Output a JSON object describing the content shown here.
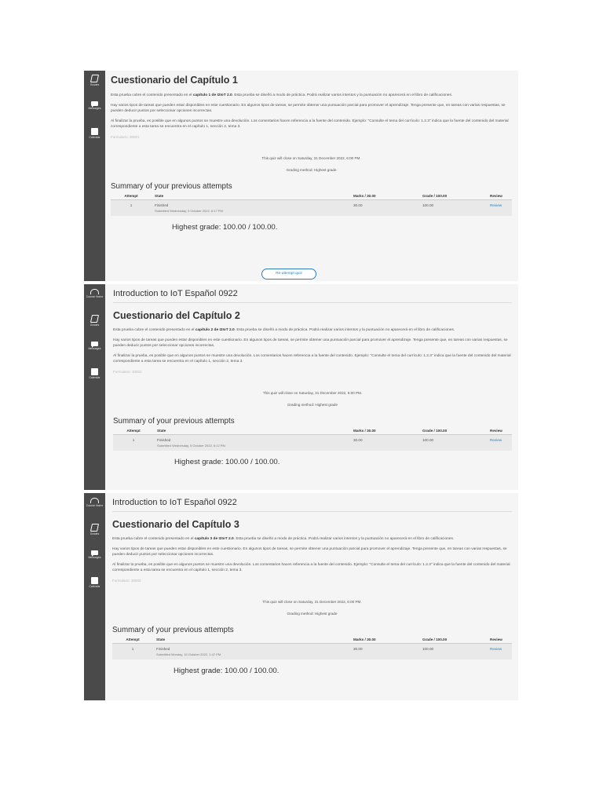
{
  "rail": {
    "course_home": "Course Home",
    "grades": "Grades",
    "messages": "Messages",
    "calendar": "Calendar"
  },
  "common": {
    "course_title": "Introduction to IoT Español 0922",
    "para2": "Hay varios tipos de tareas que pueden estar disponibles en este cuestionario. En algunos tipos de tareas, se permite obtener una puntuación parcial para promover el aprendizaje. Tenga presente que, en tareas con varias respuestas, se pueden deducir puntos por seleccionar opciones incorrectas.",
    "para3": "Al finalizar la prueba, es posible que en algunos puntos se muestre una devolución. Los comentarios hacen referencia a la fuente del contenido. Ejemplo: \"Consulte el tema del currículo: 1.2.3\" indica que la fuente del contenido del material correspondiente a esta tarea se encuentra en el capítulo 1, sección 2, tema 3.",
    "para1_pre": "Esta prueba cubre el contenido presentado en el ",
    "para1_post": ". Esta prueba se diseñó a modo de práctica. Podrá realizar varios intentos y la puntuación no aparecerá en el libro de calificaciones.",
    "close_line": "This quiz will close on Saturday, 31 December 2022, 6:00 PM.",
    "grading_method": "Grading method: Highest grade",
    "summary_title": "Summary of your previous attempts",
    "col_attempt": "Attempt",
    "col_state": "State",
    "col_marks": "Marks / 30.00",
    "col_grade": "Grade / 100.00",
    "col_review": "Review",
    "reattempt": "Re-attempt quiz"
  },
  "quizzes": [
    {
      "title": "Cuestionario del Capítulo 1",
      "bold": "capítulo 1 de I2IoT 2.0",
      "code": "Formulario: 30001",
      "attempt": "1",
      "state": "Finished",
      "submitted": "Submitted Wednesday, 5 October 2022, 6:17 PM",
      "marks": "30.00",
      "grade": "100.00",
      "review": "Review",
      "highest": "Highest grade: 100.00 / 100.00."
    },
    {
      "title": "Cuestionario del Capítulo 2",
      "bold": "capítulo 2 de I2IoT 2.0",
      "code": "Formulario: 30002",
      "attempt": "1",
      "state": "Finished",
      "submitted": "Submitted Wednesday, 5 October 2022, 6:12 PM",
      "marks": "30.00",
      "grade": "100.00",
      "review": "Review",
      "highest": "Highest grade: 100.00 / 100.00."
    },
    {
      "title": "Cuestionario del Capítulo 3",
      "bold": "capítulo 3 de I2IoT 2.0",
      "code": "Formulario: 30003",
      "attempt": "1",
      "state": "Finished",
      "submitted": "Submitted Monday, 10 October 2022, 1:47 PM",
      "marks": "30.00",
      "grade": "100.00",
      "review": "Review",
      "highest": "Highest grade: 100.00 / 100.00."
    }
  ]
}
